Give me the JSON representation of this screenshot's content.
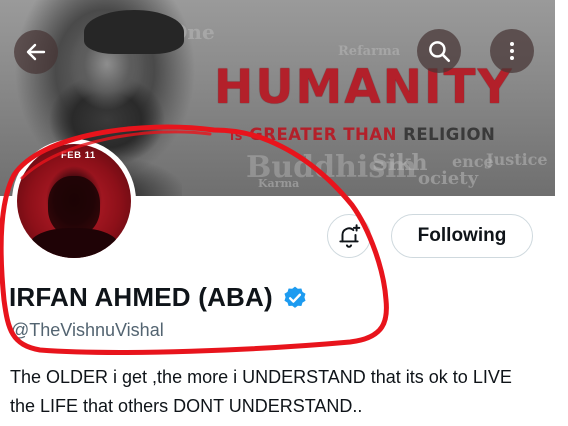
{
  "header": {
    "back_icon": "arrow-left-icon",
    "search_icon": "search-icon",
    "more_icon": "more-vertical-icon"
  },
  "banner": {
    "headline": "HUMANITY",
    "tagline_small": "IS",
    "tagline_main": "GREATER THAN",
    "tagline_end": "RELIGION",
    "collage_words": [
      "One",
      "Refarma",
      "Buddhism",
      "Karma",
      "Sikh",
      "ociety",
      "ence",
      "Justice"
    ]
  },
  "avatar": {
    "label": "FEB 11"
  },
  "actions": {
    "notify_icon": "bell-plus-icon",
    "following_label": "Following"
  },
  "profile": {
    "display_name": "IRFAN AHMED (ABA)",
    "verified_icon": "verified-badge-icon",
    "handle": "@TheVishnuVishal",
    "bio": "The OLDER i get ,the more i UNDERSTAND that its ok to LIVE the LIFE that others DONT UNDERSTAND.."
  },
  "colors": {
    "headline_red": "#b3202a",
    "verified_blue": "#1d9bf0",
    "annotation_red": "#e8141c",
    "handle_gray": "#536471"
  }
}
